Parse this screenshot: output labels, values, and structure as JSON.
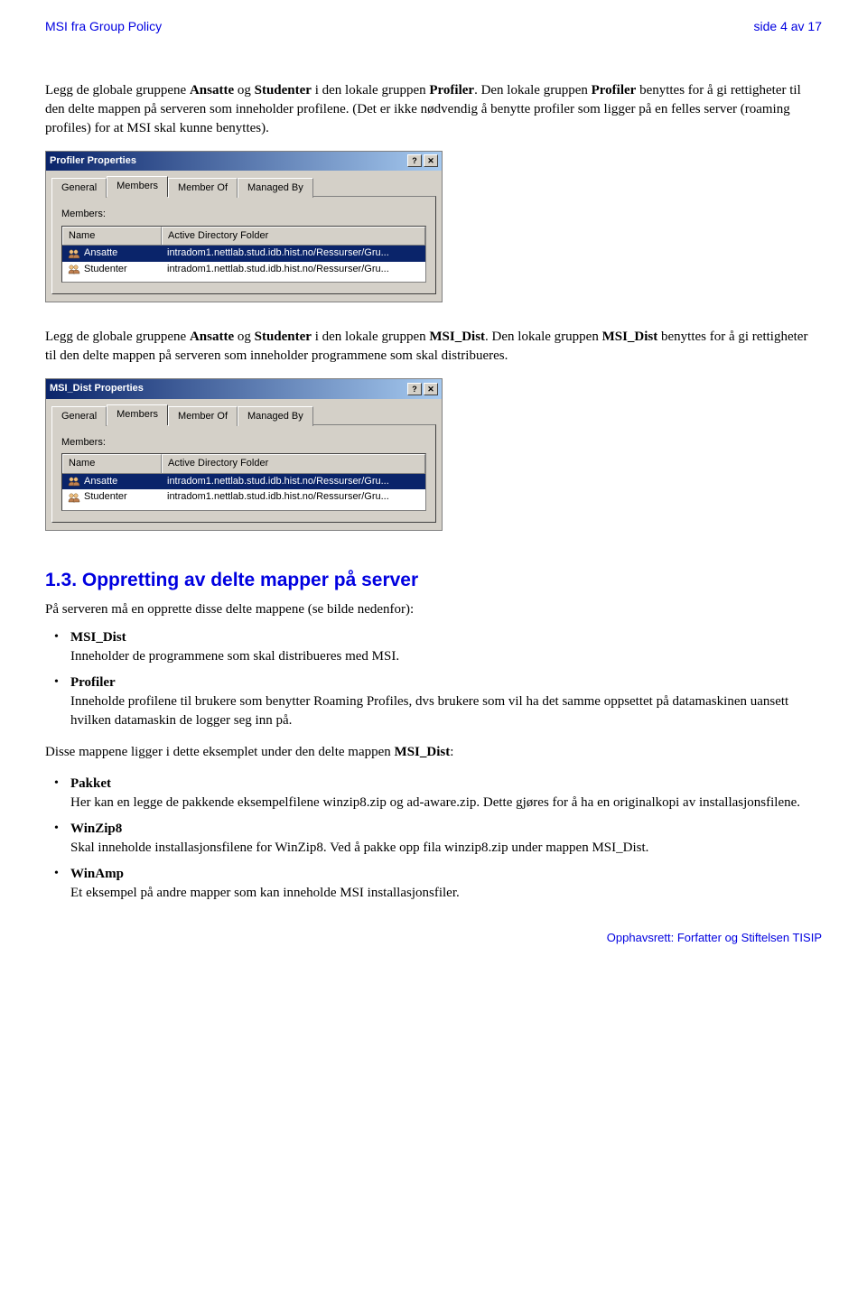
{
  "header": {
    "left": "MSI fra Group Policy",
    "right": "side 4 av 17"
  },
  "para1_pre": "Legg de globale gruppene ",
  "para1_b1": "Ansatte",
  "para1_mid1": " og ",
  "para1_b2": "Studenter",
  "para1_mid2": " i den lokale gruppen ",
  "para1_b3": "Profiler",
  "para1_post": ". Den lokale gruppen ",
  "para1_b4": "Profiler",
  "para1_tail": " benyttes for å gi rettigheter til den delte mappen på serveren som inneholder profilene. (Det er ikke nødvendig å benytte profiler som ligger på en felles server (roaming profiles) for at MSI skal kunne benyttes).",
  "dialog1": {
    "title": "Profiler Properties",
    "tabs": [
      "General",
      "Members",
      "Member Of",
      "Managed By"
    ],
    "members_label": "Members:",
    "col_name": "Name",
    "col_folder": "Active Directory Folder",
    "rows": [
      {
        "name": "Ansatte",
        "folder": "intradom1.nettlab.stud.idb.hist.no/Ressurser/Gru..."
      },
      {
        "name": "Studenter",
        "folder": "intradom1.nettlab.stud.idb.hist.no/Ressurser/Gru..."
      }
    ]
  },
  "para2_pre": "Legg de globale gruppene ",
  "para2_b1": "Ansatte",
  "para2_mid1": " og ",
  "para2_b2": "Studenter",
  "para2_mid2": " i den lokale gruppen ",
  "para2_b3": "MSI_Dist",
  "para2_post": ". Den lokale gruppen ",
  "para2_b4": "MSI_Dist",
  "para2_tail": " benyttes for å gi rettigheter til den delte mappen på serveren som inneholder programmene som skal distribueres.",
  "dialog2": {
    "title": "MSI_Dist Properties",
    "tabs": [
      "General",
      "Members",
      "Member Of",
      "Managed By"
    ],
    "members_label": "Members:",
    "col_name": "Name",
    "col_folder": "Active Directory Folder",
    "rows": [
      {
        "name": "Ansatte",
        "folder": "intradom1.nettlab.stud.idb.hist.no/Ressurser/Gru..."
      },
      {
        "name": "Studenter",
        "folder": "intradom1.nettlab.stud.idb.hist.no/Ressurser/Gru..."
      }
    ]
  },
  "section": {
    "heading": "1.3.   Oppretting av delte mapper på server",
    "intro": "På serveren må en opprette disse delte mappene (se bilde nedenfor):",
    "item1_title": "MSI_Dist",
    "item1_body": "Inneholder de programmene som skal distribueres med MSI.",
    "item2_title": "Profiler",
    "item2_body": "Inneholde profilene til brukere som benytter Roaming Profiles, dvs brukere som vil ha det samme oppsettet på datamaskinen uansett hvilken datamaskin de logger seg inn på.",
    "mid_pre": "Disse mappene ligger i dette eksemplet under den delte mappen ",
    "mid_bold": "MSI_Dist",
    "mid_post": ":",
    "item3_title": "Pakket",
    "item3_body": "Her kan en legge de pakkende eksempelfilene winzip8.zip og ad-aware.zip. Dette gjøres for å ha en originalkopi av installasjonsfilene.",
    "item4_title": "WinZip8",
    "item4_body": "Skal inneholde installasjonsfilene for WinZip8. Ved å pakke opp fila winzip8.zip under mappen MSI_Dist.",
    "item5_title": "WinAmp",
    "item5_body": "Et eksempel på andre mapper som kan inneholde MSI installasjonsfiler."
  },
  "footer": "Opphavsrett:  Forfatter og Stiftelsen TISIP"
}
